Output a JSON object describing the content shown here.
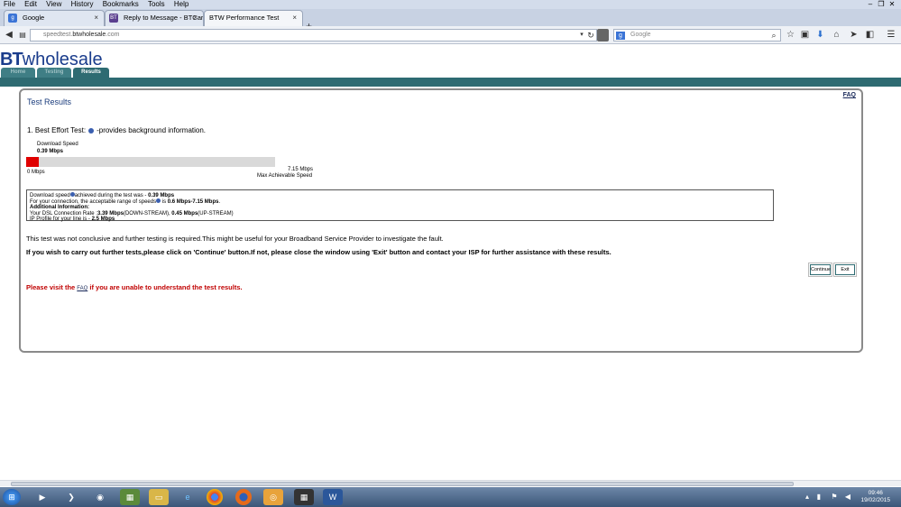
{
  "browser": {
    "menu": [
      "File",
      "Edit",
      "View",
      "History",
      "Bookmarks",
      "Tools",
      "Help"
    ],
    "tabs": [
      {
        "title": "Google",
        "favicon": "google-icon",
        "color": "#3b74d6"
      },
      {
        "title": "Reply to Message - BTCare...",
        "favicon": "bt-icon",
        "color": "#5a3f8f"
      },
      {
        "title": "BTW Performance Test",
        "favicon": "",
        "color": ""
      }
    ],
    "url_prefix": "speedtest.",
    "url_domain": "btwholesale",
    "url_suffix": ".com",
    "search_placeholder": "Google"
  },
  "page": {
    "logo_bold": "BT",
    "logo_light": "wholesale",
    "nav_tabs": [
      "Home",
      "Testing",
      "Results"
    ],
    "faq_link": "FAQ",
    "results_title": "Test Results",
    "best_effort_prefix": "1. Best Effort Test:",
    "best_effort_suffix": "-provides background information.",
    "download_speed_label": "Download  Speed",
    "download_speed_value": "0.39 Mbps",
    "bar_min": "0 Mbps",
    "bar_max": "7.15 Mbps",
    "bar_max_caption": "Max Achievable Speed",
    "bar": {
      "value": 0.39,
      "max": 7.15
    },
    "info": {
      "line1_a": "Download speed",
      "line1_b": "achieved during the test was - ",
      "line1_val": "0.39 Mbps",
      "line2_a": "For your connection, the acceptable range of speeds",
      "line2_b": " is ",
      "line2_val": "0.6 Mbps-7.15 Mbps",
      "line2_end": ".",
      "line3": "Additional Information:",
      "line4_a": "Your DSL Connection Rate :",
      "line4_v1": "3.39 Mbps",
      "line4_b": "(DOWN-STREAM), ",
      "line4_v2": "0.45 Mbps",
      "line4_c": "(UP-STREAM)",
      "line5_a": "IP Profile for your line is - ",
      "line5_val": "2.5 Mbps"
    },
    "conclusive_text": "This test was not conclusive and further testing is required.This might be useful for your Broadband Service Provider to investigate the fault.",
    "further_text": "If you wish to carry out further tests,please click on 'Continue' button.If not, please close the window using 'Exit' button and contact your ISP for further assistance with these results.",
    "continue_label": "Continue",
    "exit_label": "Exit",
    "visit_a": "Please visit the ",
    "visit_link": "FAQ",
    "visit_b": " if you are unable to understand the test results."
  },
  "taskbar": {
    "time": "09:46",
    "date": "19/02/2015"
  }
}
